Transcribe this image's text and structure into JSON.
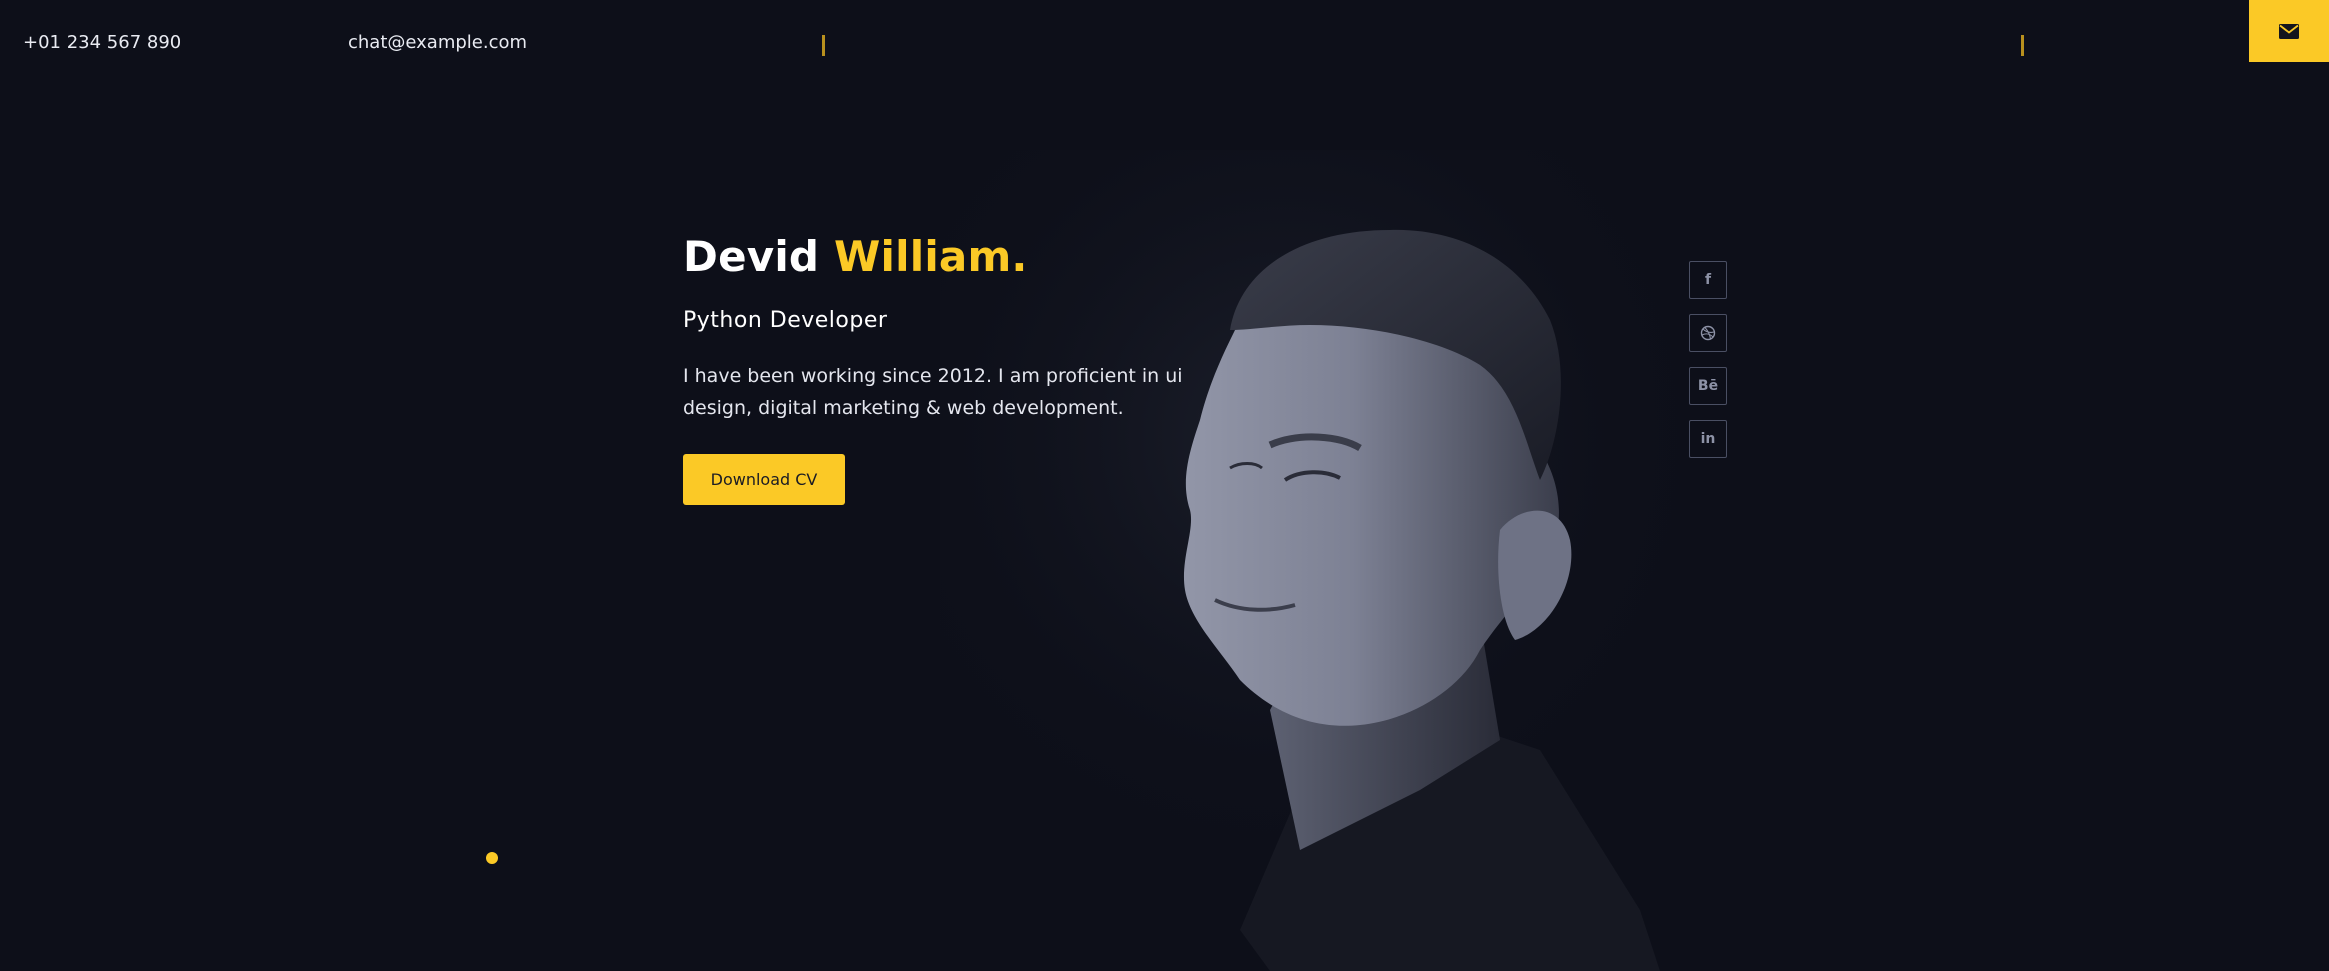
{
  "topbar": {
    "phone": "+01 234 567 890",
    "email": "chat@example.com",
    "mail_icon": "envelope-icon"
  },
  "hero": {
    "first_name": "Devid",
    "last_name": "William.",
    "role": "Python Developer",
    "description": "I have been working since 2012. I am proficient in ui design, digital marketing & web development.",
    "cv_button_label": "Download CV"
  },
  "social": {
    "items": [
      {
        "name": "facebook",
        "icon": "facebook-icon",
        "glyph": "f"
      },
      {
        "name": "dribbble",
        "icon": "dribbble-icon",
        "glyph": ""
      },
      {
        "name": "behance",
        "icon": "behance-icon",
        "glyph": "Bē"
      },
      {
        "name": "linkedin",
        "icon": "linkedin-icon",
        "glyph": "in"
      }
    ]
  },
  "colors": {
    "background": "#0d0f19",
    "accent": "#fbc926",
    "text": "#ffffff",
    "muted_icon": "#8d92a6"
  }
}
